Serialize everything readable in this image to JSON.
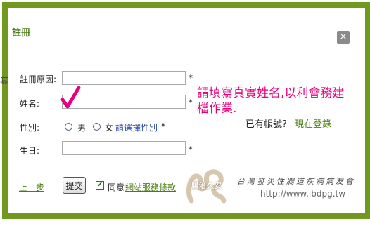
{
  "dialog": {
    "title": "註冊",
    "close_label": "×"
  },
  "stray_text": "其",
  "form": {
    "fields": {
      "reason": {
        "label": "註冊原因:",
        "value": "",
        "required_mark": "*"
      },
      "name": {
        "label": "姓名:",
        "value": "",
        "required_mark": "*"
      },
      "gender": {
        "label": "性別:",
        "options": [
          "男",
          "女"
        ],
        "hint": "請選擇性別",
        "required_mark": "*"
      },
      "birthday": {
        "label": "生日:",
        "value": "",
        "required_mark": "*"
      }
    },
    "prev_link": "上一步",
    "submit_label": "提交",
    "agree_prefix": "同意",
    "terms_link": "網站服務條款",
    "agree_checked": true
  },
  "annotation": {
    "line1": "請填寫真實姓名,以利會務建",
    "line2": "檔作業.",
    "color": "#e6007e"
  },
  "account": {
    "label": "已有帳號?",
    "login_link": "現在登錄"
  },
  "watermark": {
    "brand": "腸治久安",
    "org_name": "台灣發炎性腸道疾病病友會",
    "url": "http://www.ibdpg.tw"
  },
  "colors": {
    "frame": "#6f9a1f",
    "link": "#4b7d10",
    "hint": "#2b4aa3"
  }
}
